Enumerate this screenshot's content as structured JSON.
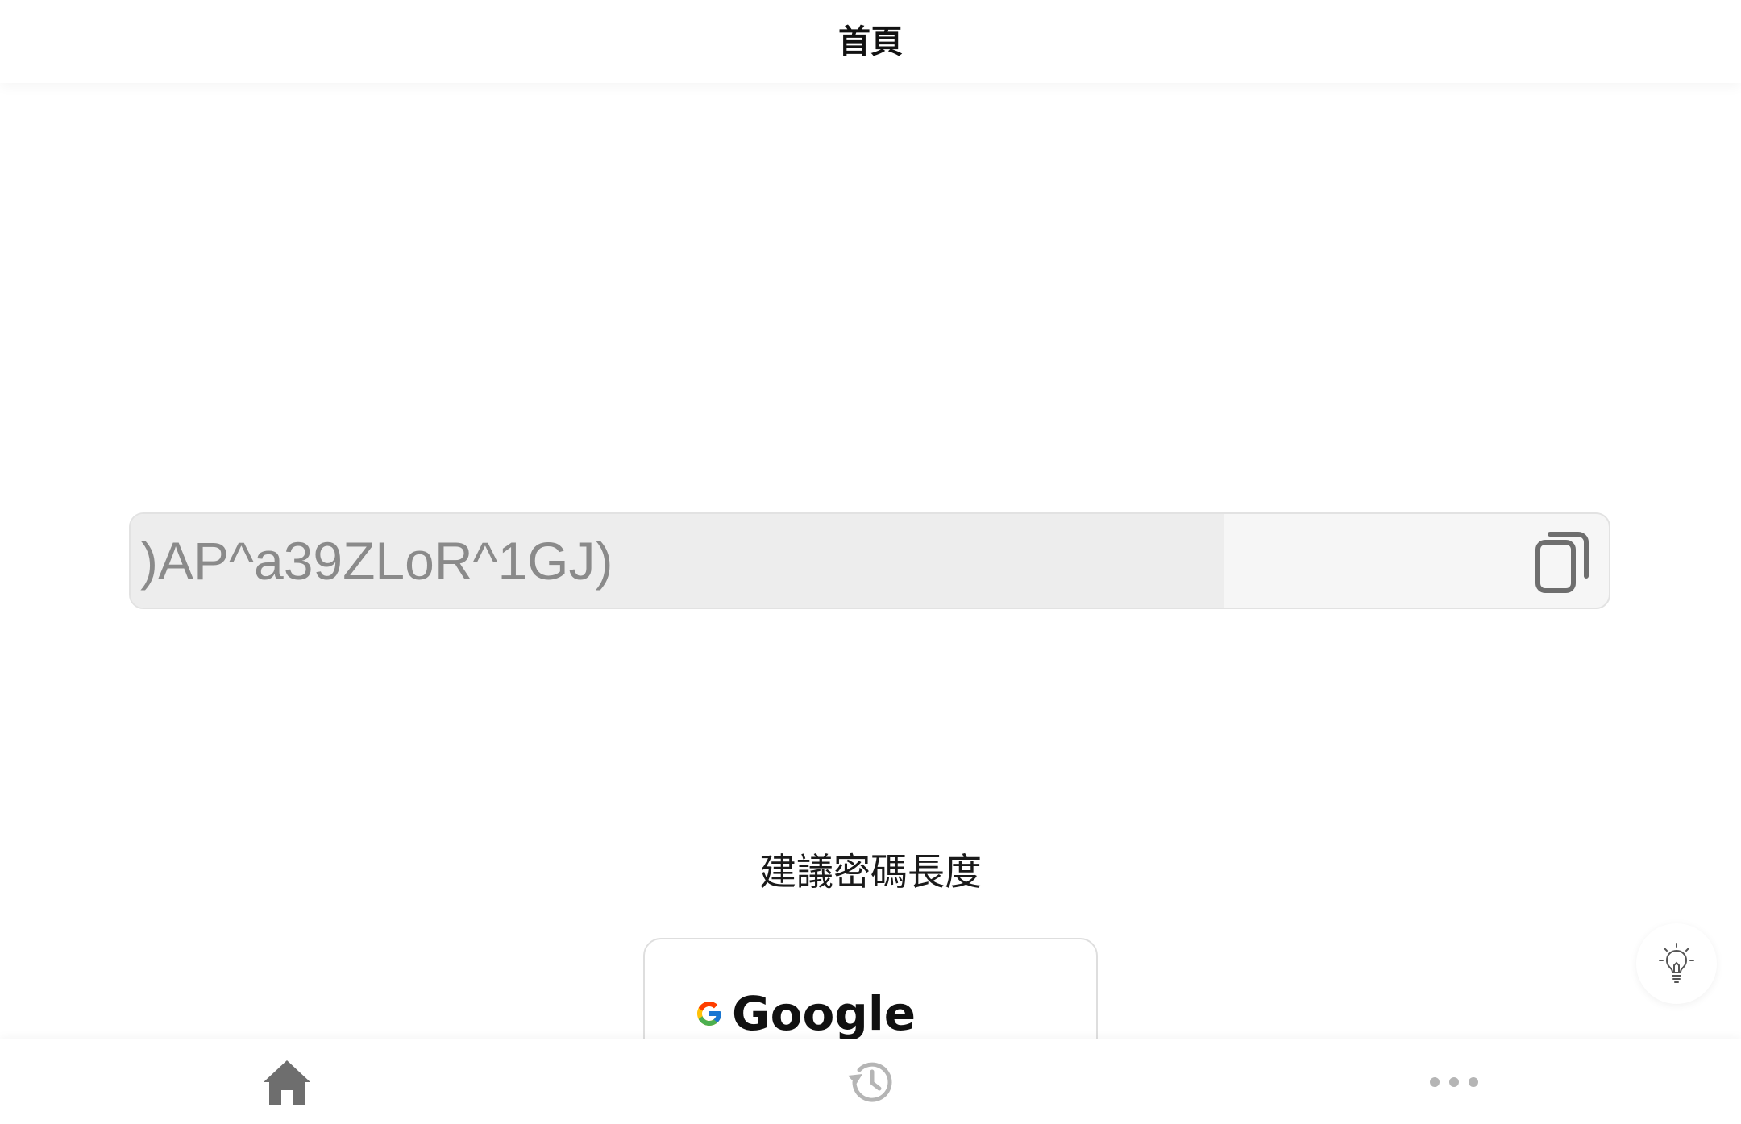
{
  "header": {
    "title": "首頁"
  },
  "password": {
    "value": ")AP^a39ZLoR^1GJ)",
    "strength_fraction": 0.74,
    "copy_icon": "copy-icon"
  },
  "recommendation": {
    "title": "建議密碼長度",
    "cards": [
      {
        "provider": "Google",
        "icon": "google-logo"
      }
    ]
  },
  "hint_button": {
    "icon": "lightbulb-icon"
  },
  "tabbar": {
    "tabs": [
      {
        "id": "home",
        "icon": "home-icon",
        "active": true
      },
      {
        "id": "history",
        "icon": "history-icon",
        "active": false
      },
      {
        "id": "more",
        "icon": "more-dots-icon",
        "active": false
      }
    ]
  },
  "colors": {
    "active_icon": "#6e6e6e",
    "inactive_icon": "#b5b5b5",
    "password_text": "#8a8a8a",
    "field_background": "#f6f6f6",
    "strength_fill": "#ededed"
  }
}
